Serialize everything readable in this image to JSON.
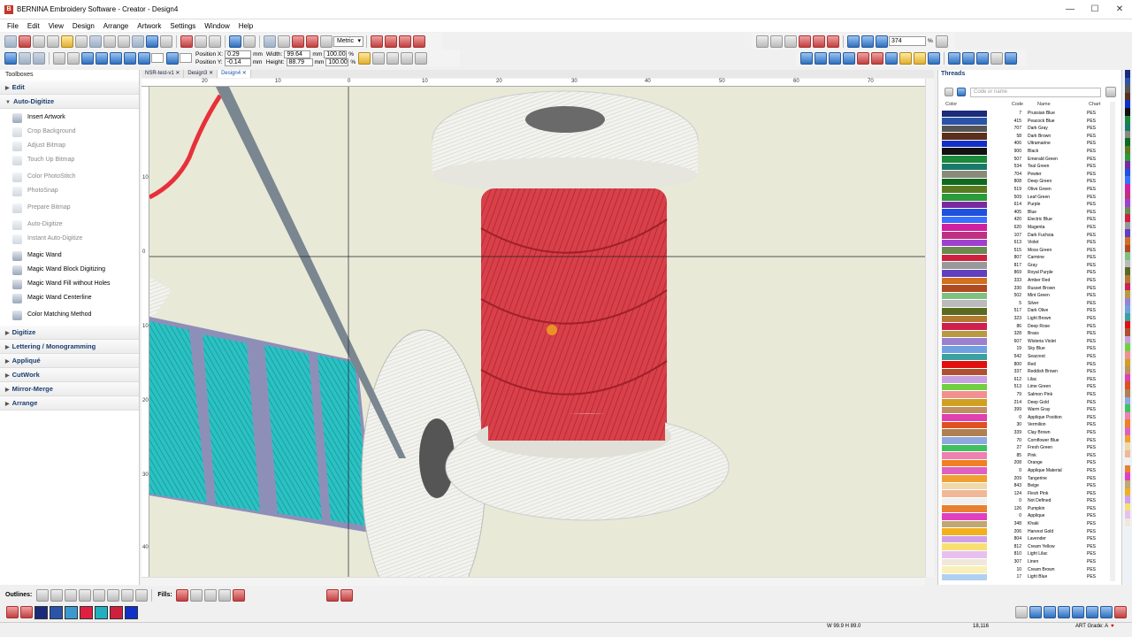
{
  "window": {
    "title": "BERNINA Embroidery Software - Creator - Design4",
    "app_icon_letter": "B"
  },
  "menu": [
    "File",
    "Edit",
    "View",
    "Design",
    "Arrange",
    "Artwork",
    "Settings",
    "Window",
    "Help"
  ],
  "toolbar1": {
    "units": "Metric",
    "zoom_value": "374",
    "zoom_unit": "%"
  },
  "toolbar2": {
    "position_x_label": "Position X:",
    "position_x": "0.29",
    "position_y_label": "Position Y:",
    "position_y": "-0.14",
    "unit_mm": "mm",
    "width_label": "Width:",
    "width": "99.64",
    "height_label": "Height:",
    "height": "88.79",
    "scale_w": "100.00",
    "scale_h": "100.00",
    "pct": "%"
  },
  "toolboxes": {
    "header": "Toolboxes",
    "sections": [
      {
        "label": "Edit",
        "expanded": false
      },
      {
        "label": "Auto-Digitize",
        "expanded": true
      }
    ],
    "items": [
      {
        "label": "Insert Artwork",
        "enabled": true
      },
      {
        "label": "Crop Background",
        "enabled": false
      },
      {
        "label": "Adjust Bitmap",
        "enabled": false
      },
      {
        "label": "Touch Up Bitmap",
        "enabled": false
      },
      {
        "label": "Color PhotoStitch",
        "enabled": false
      },
      {
        "label": "PhotoSnap",
        "enabled": false
      },
      {
        "label": "Prepare Bitmap",
        "enabled": false
      },
      {
        "label": "Auto-Digitize",
        "enabled": false
      },
      {
        "label": "Instant Auto-Digitize",
        "enabled": false
      },
      {
        "label": "Magic Wand",
        "enabled": true
      },
      {
        "label": "Magic Wand Block Digitizing",
        "enabled": true
      },
      {
        "label": "Magic Wand Fill without Holes",
        "enabled": true
      },
      {
        "label": "Magic Wand Centerline",
        "enabled": true
      },
      {
        "label": "Color Matching Method",
        "enabled": true
      }
    ],
    "more_sections": [
      "Digitize",
      "Lettering / Monogramming",
      "Appliqué",
      "CutWork",
      "Mirror-Merge",
      "Arrange"
    ]
  },
  "tabs": [
    "NSR-test-v1",
    "Design3",
    "Design4"
  ],
  "ruler_h": [
    "20",
    "10",
    "0",
    "10",
    "20",
    "30",
    "40",
    "50",
    "60",
    "70"
  ],
  "ruler_v": [
    "10",
    "0",
    "10",
    "20",
    "30",
    "40"
  ],
  "threads": {
    "title": "Threads",
    "search_placeholder": "Code or name",
    "columns": [
      "Color",
      "Code",
      "Name",
      "Chart"
    ],
    "rows": [
      {
        "color": "#1c2a7a",
        "code": "7",
        "name": "Prussian Blue",
        "chart": "PES"
      },
      {
        "color": "#2b54a8",
        "code": "415",
        "name": "Peacock Blue",
        "chart": "PES"
      },
      {
        "color": "#555555",
        "code": "707",
        "name": "Dark Gray",
        "chart": "PES"
      },
      {
        "color": "#5a2f1c",
        "code": "58",
        "name": "Dark Brown",
        "chart": "PES"
      },
      {
        "color": "#1030c8",
        "code": "406",
        "name": "Ultramarine",
        "chart": "PES"
      },
      {
        "color": "#111111",
        "code": "900",
        "name": "Black",
        "chart": "PES"
      },
      {
        "color": "#1a8a3a",
        "code": "507",
        "name": "Emerald Green",
        "chart": "PES"
      },
      {
        "color": "#1a7a6a",
        "code": "534",
        "name": "Teal Green",
        "chart": "PES"
      },
      {
        "color": "#8a8a7a",
        "code": "704",
        "name": "Pewter",
        "chart": "PES"
      },
      {
        "color": "#0f6a20",
        "code": "808",
        "name": "Deep Green",
        "chart": "PES"
      },
      {
        "color": "#5a7a20",
        "code": "519",
        "name": "Olive Green",
        "chart": "PES"
      },
      {
        "color": "#2a9a3a",
        "code": "509",
        "name": "Leaf Green",
        "chart": "PES"
      },
      {
        "color": "#7a2aa0",
        "code": "614",
        "name": "Purple",
        "chart": "PES"
      },
      {
        "color": "#2050e0",
        "code": "405",
        "name": "Blue",
        "chart": "PES"
      },
      {
        "color": "#3a70ff",
        "code": "420",
        "name": "Electric Blue",
        "chart": "PES"
      },
      {
        "color": "#d020a0",
        "code": "620",
        "name": "Magenta",
        "chart": "PES"
      },
      {
        "color": "#c03080",
        "code": "107",
        "name": "Dark Fuchsia",
        "chart": "PES"
      },
      {
        "color": "#a040d0",
        "code": "613",
        "name": "Violet",
        "chart": "PES"
      },
      {
        "color": "#6a8a50",
        "code": "515",
        "name": "Moss Green",
        "chart": "PES"
      },
      {
        "color": "#d02040",
        "code": "807",
        "name": "Carmine",
        "chart": "PES"
      },
      {
        "color": "#999999",
        "code": "817",
        "name": "Gray",
        "chart": "PES"
      },
      {
        "color": "#6040c0",
        "code": "869",
        "name": "Royal Purple",
        "chart": "PES"
      },
      {
        "color": "#d07020",
        "code": "333",
        "name": "Amber Red",
        "chart": "PES"
      },
      {
        "color": "#b04a20",
        "code": "330",
        "name": "Russet Brown",
        "chart": "PES"
      },
      {
        "color": "#80c080",
        "code": "502",
        "name": "Mint Green",
        "chart": "PES"
      },
      {
        "color": "#bbbbbb",
        "code": "5",
        "name": "Silver",
        "chart": "PES"
      },
      {
        "color": "#5a6a20",
        "code": "517",
        "name": "Dark Olive",
        "chart": "PES"
      },
      {
        "color": "#b07a30",
        "code": "323",
        "name": "Light Brown",
        "chart": "PES"
      },
      {
        "color": "#d02050",
        "code": "86",
        "name": "Deep Rose",
        "chart": "PES"
      },
      {
        "color": "#b89a40",
        "code": "328",
        "name": "Brass",
        "chart": "PES"
      },
      {
        "color": "#9a80d0",
        "code": "607",
        "name": "Wisteria Violet",
        "chart": "PES"
      },
      {
        "color": "#70a0e0",
        "code": "19",
        "name": "Sky Blue",
        "chart": "PES"
      },
      {
        "color": "#3aa0a0",
        "code": "542",
        "name": "Seacrest",
        "chart": "PES"
      },
      {
        "color": "#e01010",
        "code": "800",
        "name": "Red",
        "chart": "PES"
      },
      {
        "color": "#b05030",
        "code": "337",
        "name": "Reddish Brown",
        "chart": "PES"
      },
      {
        "color": "#c8a0e0",
        "code": "612",
        "name": "Lilac",
        "chart": "PES"
      },
      {
        "color": "#70d040",
        "code": "513",
        "name": "Lime Green",
        "chart": "PES"
      },
      {
        "color": "#f09090",
        "code": "79",
        "name": "Salmon Pink",
        "chart": "PES"
      },
      {
        "color": "#d0a020",
        "code": "214",
        "name": "Deep Gold",
        "chart": "PES"
      },
      {
        "color": "#c09060",
        "code": "399",
        "name": "Warm Gray",
        "chart": "PES"
      },
      {
        "color": "#e040b0",
        "code": "0",
        "name": "Applique Position",
        "chart": "PES"
      },
      {
        "color": "#e05020",
        "code": "30",
        "name": "Vermilion",
        "chart": "PES"
      },
      {
        "color": "#b08050",
        "code": "339",
        "name": "Clay Brown",
        "chart": "PES"
      },
      {
        "color": "#90a8e0",
        "code": "70",
        "name": "Cornflower Blue",
        "chart": "PES"
      },
      {
        "color": "#40c060",
        "code": "27",
        "name": "Fresh Green",
        "chart": "PES"
      },
      {
        "color": "#f080b0",
        "code": "85",
        "name": "Pink",
        "chart": "PES"
      },
      {
        "color": "#f08020",
        "code": "208",
        "name": "Orange",
        "chart": "PES"
      },
      {
        "color": "#e060c0",
        "code": "0",
        "name": "Applique Material",
        "chart": "PES"
      },
      {
        "color": "#f0a030",
        "code": "209",
        "name": "Tangerine",
        "chart": "PES"
      },
      {
        "color": "#f0d8a8",
        "code": "843",
        "name": "Beige",
        "chart": "PES"
      },
      {
        "color": "#f0b898",
        "code": "124",
        "name": "Flesh Pink",
        "chart": "PES"
      },
      {
        "color": "#f0f0f0",
        "code": "0",
        "name": "Not Defined",
        "chart": "PES"
      },
      {
        "color": "#e88030",
        "code": "126",
        "name": "Pumpkin",
        "chart": "PES"
      },
      {
        "color": "#e040c0",
        "code": "0",
        "name": "Applique",
        "chart": "PES"
      },
      {
        "color": "#c0a870",
        "code": "348",
        "name": "Khaki",
        "chart": "PES"
      },
      {
        "color": "#f0b020",
        "code": "206",
        "name": "Harvest Gold",
        "chart": "PES"
      },
      {
        "color": "#d0a0e8",
        "code": "804",
        "name": "Lavender",
        "chart": "PES"
      },
      {
        "color": "#f8e070",
        "code": "812",
        "name": "Cream Yellow",
        "chart": "PES"
      },
      {
        "color": "#e8c0f0",
        "code": "810",
        "name": "Light Lilac",
        "chart": "PES"
      },
      {
        "color": "#f0e8d8",
        "code": "307",
        "name": "Linen",
        "chart": "PES"
      },
      {
        "color": "#f8f0b8",
        "code": "10",
        "name": "Cream Brown",
        "chart": "PES"
      },
      {
        "color": "#b0d0f0",
        "code": "17",
        "name": "Light Blue",
        "chart": "PES"
      }
    ]
  },
  "bottom": {
    "outlines_label": "Outlines:",
    "fills_label": "Fills:"
  },
  "palette": [
    "#1c2a7a",
    "#2b54a8",
    "#3a9ad0",
    "#e02040",
    "#20b0c0",
    "#d02040",
    "#1030c8"
  ],
  "status": {
    "dims": "W 99.9 H 89.0",
    "stitches": "18,116",
    "grade": "ART Grade: A"
  },
  "colors": {
    "accent": "#1a3d6e",
    "spool_red": "#d8404a",
    "teal": "#2ac2c2",
    "canvas_bg": "#e9e9d8"
  }
}
